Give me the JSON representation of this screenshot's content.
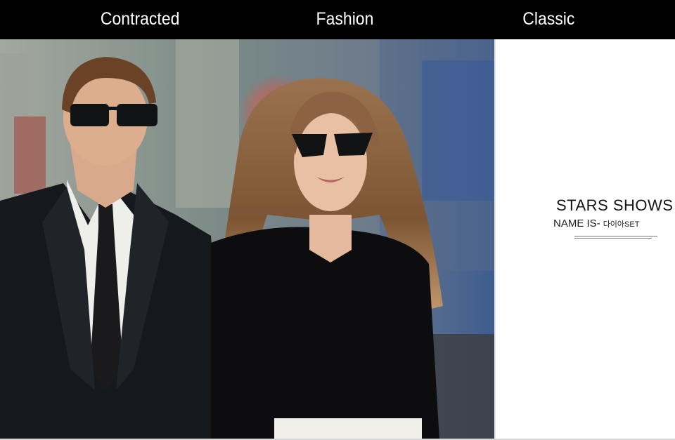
{
  "header": {
    "labels": [
      "Contracted",
      "Fashion",
      "Classic"
    ]
  },
  "photo": {
    "subject": "man and woman in black outfits wearing sunglasses on a city street",
    "description_hidden": true
  },
  "panel": {
    "title": "STARS SHOWS",
    "name_label": "NAME IS-",
    "name_value": "다이아SET"
  },
  "colors": {
    "header_bg": "#000000",
    "header_text": "#ffffff",
    "panel_bg": "#ffffff"
  }
}
